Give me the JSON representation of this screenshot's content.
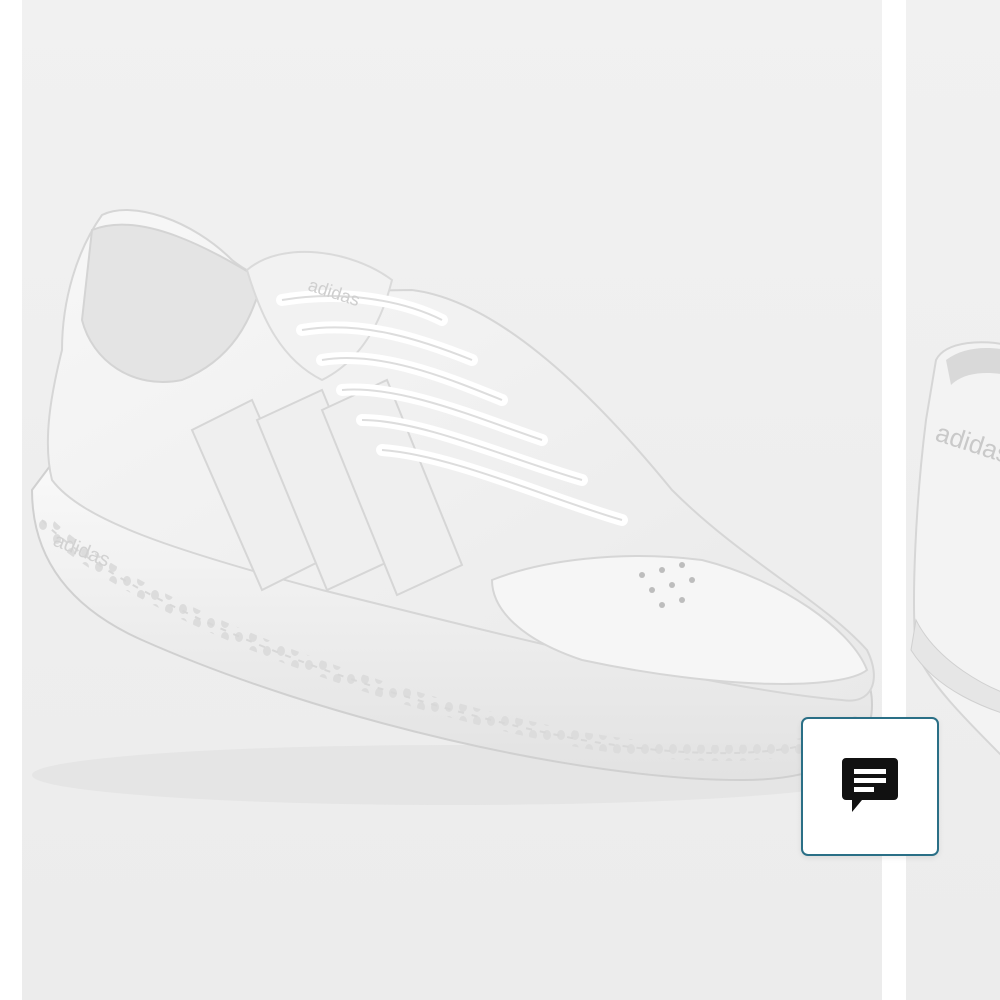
{
  "product_image": {
    "brand_mark": "adidas",
    "alt": "adidas"
  },
  "next_image": {
    "brand_mark": "adidas"
  },
  "chat_button": {
    "icon": "chat-feedback-icon",
    "aria_label": ""
  },
  "colors": {
    "accent_border": "#2a6f86",
    "icon": "#111111",
    "background": "#eeeeee"
  }
}
